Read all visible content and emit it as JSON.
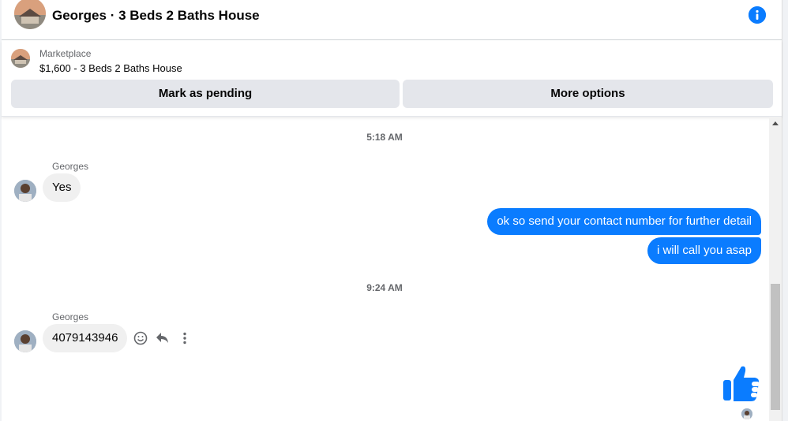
{
  "header": {
    "title": "Georges · 3 Beds 2 Baths House",
    "info_icon": "info-icon",
    "accent_color": "#0a7cff"
  },
  "listing": {
    "source": "Marketplace",
    "item": "$1,600 - 3 Beds 2 Baths House",
    "buttons": {
      "pending": "Mark as pending",
      "more": "More options"
    }
  },
  "thread": {
    "timestamps": [
      "5:18 AM",
      "9:24 AM"
    ],
    "messages": [
      {
        "sender": "Georges",
        "text": "Yes",
        "direction": "incoming"
      },
      {
        "sender": "me",
        "text": "ok so send your contact number for further detail",
        "direction": "outgoing"
      },
      {
        "sender": "me",
        "text": "i will call you asap",
        "direction": "outgoing"
      },
      {
        "sender": "Georges",
        "text": "4079143946",
        "direction": "incoming"
      },
      {
        "sender": "me",
        "text": "",
        "direction": "outgoing",
        "type": "like",
        "icon": "thumbs-up-icon"
      }
    ],
    "message_actions": [
      "smiley-icon",
      "reply-icon",
      "more-vertical-icon"
    ],
    "outgoing_color": "#0a7cff",
    "incoming_color": "#f0f0f0"
  }
}
